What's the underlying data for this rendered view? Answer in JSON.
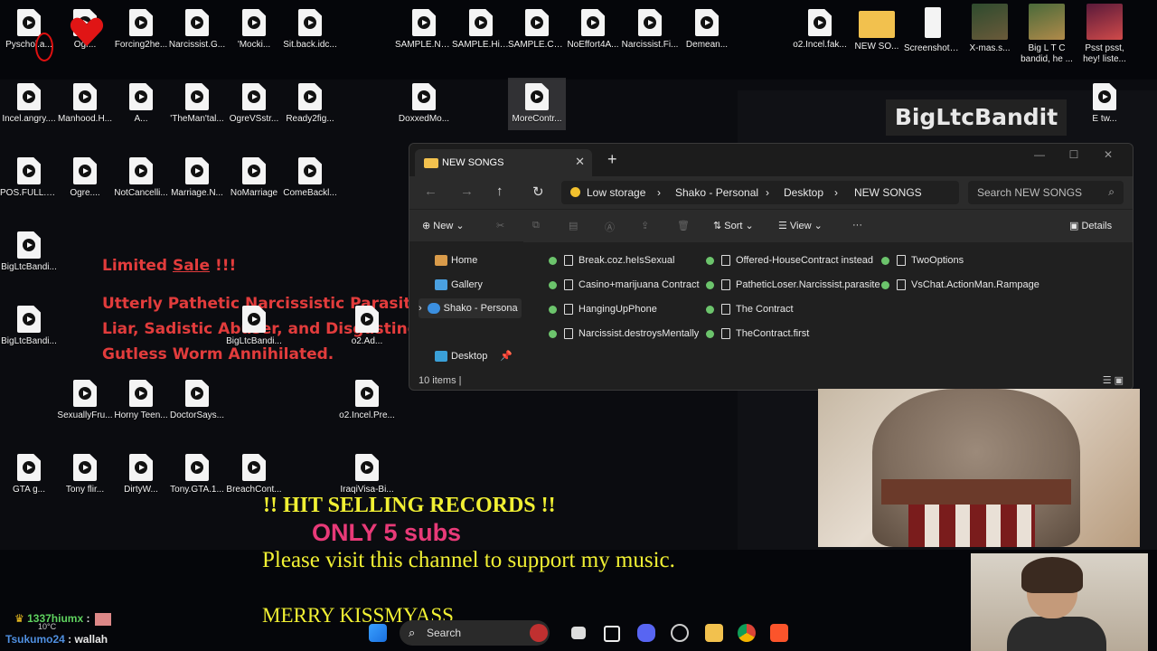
{
  "desktop": {
    "icons_row1": [
      "Pyschol.a...",
      "Ogr...",
      "Forcing2he...",
      "Narcissist.G...",
      "'Mocki...",
      "Sit.back.idc...",
      "SAMPLE.Na...",
      "SAMPLE.Hid...",
      "SAMPLE.Ca...",
      "NoEffort4A...",
      "Narcissist.Fi...",
      "Demean...",
      "o2.Incel.fak...",
      "NEW SO...",
      "Screenshot_...",
      "X-mas.s...",
      "Big L T C bandid, he ...",
      "Psst psst, hey! liste..."
    ],
    "icons_row2": [
      "Incel.angry....",
      "Manhood.H...",
      "A...",
      "'TheMan'tal...",
      "OgreVSstr...",
      "Ready2fig...",
      "DoxxedMo...",
      "MoreContr...",
      "E tw..."
    ],
    "icons_row3": [
      "POS.FULL.N...",
      "Ogre....",
      "NotCancelli...",
      "Marriage.N...",
      "NoMarriage",
      "ComeBackl..."
    ],
    "icons_left": [
      "BigLtcBandi...",
      "BigLtcBandi..."
    ],
    "icons_mid": [
      "BigLtcBandi...",
      "o2.Ad..."
    ],
    "icons_row6": [
      "SexuallyFru...",
      "Horny Teen...",
      "DoctorSays...",
      "o2.Incel.Pre..."
    ],
    "icons_row7": [
      "GTA g...",
      "Tony flir...",
      "DirtyW...",
      "Tony.GTA.1...",
      "BreachCont...",
      "IraqiVisa-Bi..."
    ]
  },
  "promo": {
    "prefix": "Limited ",
    "sale": "Sale",
    "suffix": " !!!",
    "body": "Utterly Pathetic Narcissistic Parasite, Liar, Sadistic Abuser, and Disgusting Gutless Worm Annihilated."
  },
  "brand_banner": "BigLtcBandit",
  "explorer": {
    "tab_title": "NEW SONGS",
    "new_tab": "+",
    "breadcrumb": [
      "Low storage",
      "Shako - Personal",
      "Desktop",
      "NEW SONGS"
    ],
    "search_placeholder": "Search NEW SONGS",
    "toolbar": {
      "new": "New",
      "sort": "Sort",
      "view": "View",
      "more": "···",
      "details": "Details"
    },
    "nav": [
      "Home",
      "Gallery",
      "Shako - Persona",
      "Desktop"
    ],
    "files": [
      "Break.coz.heIsSexual",
      "Casino+marijuana Contract",
      "HangingUpPhone",
      "Narcissist.destroysMentally",
      "Offered-HouseContract instead",
      "PatheticLoser.Narcissist.parasite",
      "The Contract",
      "TheContract.first",
      "TwoOptions",
      "VsChat.ActionMan.Rampage"
    ],
    "status": "10 items  |"
  },
  "overlay": {
    "hit": "!! HIT SELLING RECORDS !!",
    "only": "ONLY 5 subs",
    "visit": "Please visit this channel to support my music.",
    "merry": "MERRY KISSMYASS"
  },
  "chat": [
    {
      "user": "1337hiumx",
      "msg": " :"
    },
    {
      "user": "Tsukumo24",
      "msg": " : wallah"
    }
  ],
  "weather": "10°C",
  "taskbar": {
    "search": "Search"
  },
  "colors": {
    "promo_red": "#e23c3c",
    "overlay_yellow": "#f1f033",
    "overlay_pink": "#e83a78"
  }
}
